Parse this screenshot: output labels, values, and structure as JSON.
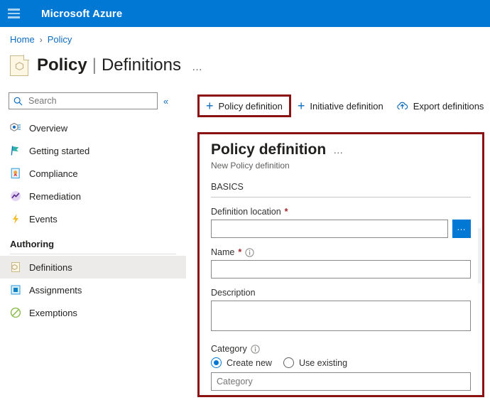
{
  "topbar": {
    "menu_icon": "hamburger-icon",
    "brand": "Microsoft Azure"
  },
  "breadcrumb": {
    "items": [
      "Home",
      "Policy"
    ],
    "separator": "›"
  },
  "header": {
    "icon": "policy-icon",
    "title_bold": "Policy",
    "separator": "|",
    "title_light": "Definitions",
    "more_menu": "…"
  },
  "sidebar": {
    "search": {
      "placeholder": "Search",
      "value": "",
      "icon": "search-icon"
    },
    "collapse_icon": "«",
    "items": [
      {
        "label": "Overview",
        "icon": "overview-icon",
        "selected": false
      },
      {
        "label": "Getting started",
        "icon": "flag-icon",
        "selected": false
      },
      {
        "label": "Compliance",
        "icon": "compliance-icon",
        "selected": false
      },
      {
        "label": "Remediation",
        "icon": "remediation-icon",
        "selected": false
      },
      {
        "label": "Events",
        "icon": "lightning-icon",
        "selected": false
      }
    ],
    "group_title": "Authoring",
    "group_items": [
      {
        "label": "Definitions",
        "icon": "definitions-icon",
        "selected": true
      },
      {
        "label": "Assignments",
        "icon": "assignments-icon",
        "selected": false
      },
      {
        "label": "Exemptions",
        "icon": "exemptions-icon",
        "selected": false
      }
    ]
  },
  "commandbar": {
    "buttons": [
      {
        "label": "Policy definition",
        "icon": "plus-icon",
        "highlighted": true
      },
      {
        "label": "Initiative definition",
        "icon": "plus-icon",
        "highlighted": false
      },
      {
        "label": "Export definitions",
        "icon": "cloud-upload-icon",
        "highlighted": false
      }
    ]
  },
  "panel": {
    "title": "Policy definition",
    "more_menu": "…",
    "subtitle": "New Policy definition",
    "section_label": "BASICS",
    "fields": {
      "definition_location": {
        "label": "Definition location",
        "required_marker": "*",
        "value": "",
        "placeholder": "",
        "browse_button": "…"
      },
      "name": {
        "label": "Name",
        "required_marker": "*",
        "info_icon": "info-icon",
        "value": "",
        "placeholder": ""
      },
      "description": {
        "label": "Description",
        "value": "",
        "placeholder": ""
      },
      "category": {
        "label": "Category",
        "info_icon": "info-icon",
        "options": [
          {
            "label": "Create new",
            "selected": true
          },
          {
            "label": "Use existing",
            "selected": false
          }
        ],
        "input_placeholder": "Category",
        "input_value": ""
      }
    }
  },
  "colors": {
    "azure_blue": "#0078d4",
    "link_blue": "#0f6cbd",
    "highlight_red": "#8a1212",
    "required_red": "#a4262c",
    "selected_gray": "#edebe9"
  }
}
